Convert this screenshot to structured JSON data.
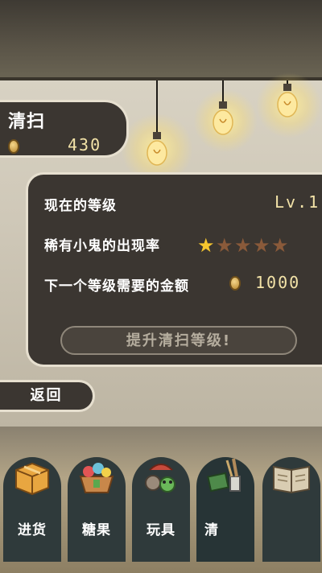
{
  "shop": {
    "title": "清扫",
    "money": "430"
  },
  "info": {
    "level_label": "现在的等级",
    "level_value": "Lv.1",
    "rarity_label": "稀有小鬼的出现率",
    "rarity_stars": {
      "filled": 1,
      "total": 5
    },
    "next_cost_label": "下一个等级需要的金额",
    "next_cost_value": "1000",
    "upgrade_button": "提升清扫等级!"
  },
  "back_button": "返回",
  "nav": {
    "items": [
      {
        "label": "进货",
        "icon": "box-icon"
      },
      {
        "label": "糖果",
        "icon": "candy-basket-icon"
      },
      {
        "label": "玩具",
        "icon": "toys-icon"
      },
      {
        "label": "清",
        "icon": "cleaning-tools-icon"
      },
      {
        "label": "",
        "icon": "book-icon"
      }
    ]
  },
  "colors": {
    "panel_bg": "#3b3631",
    "panel_border": "#e6dfcf",
    "value_text": "#f3e3a8",
    "star_on": "#f5c62e",
    "star_off": "#8a5a3a"
  }
}
